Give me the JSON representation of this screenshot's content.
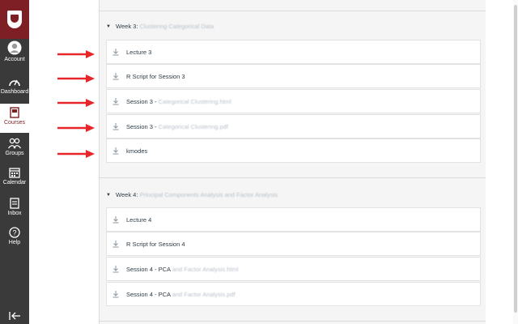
{
  "nav": {
    "items": [
      {
        "label": "Account",
        "icon": "account-icon"
      },
      {
        "label": "Dashboard",
        "icon": "dashboard-icon"
      },
      {
        "label": "Courses",
        "icon": "courses-icon",
        "active": true
      },
      {
        "label": "Groups",
        "icon": "groups-icon"
      },
      {
        "label": "Calendar",
        "icon": "calendar-icon"
      },
      {
        "label": "Inbox",
        "icon": "inbox-icon"
      },
      {
        "label": "Help",
        "icon": "help-icon"
      }
    ],
    "collapse_icon": "collapse-nav-icon"
  },
  "modules": [
    {
      "heading": "Week 3:",
      "heading_blurred": "Clustering Categorical Data",
      "items": [
        {
          "title": "Lecture 3",
          "title_blurred": ""
        },
        {
          "title": "R Script for Session 3",
          "title_blurred": ""
        },
        {
          "title": "Session 3 - ",
          "title_blurred": "Categorical Clustering.html"
        },
        {
          "title": "Session 3 - ",
          "title_blurred": "Categorical Clustering.pdf"
        },
        {
          "title": "kmodes",
          "title_blurred": ""
        }
      ]
    },
    {
      "heading": "Week 4:",
      "heading_blurred": "Principal Components Analysis and Factor Analysis",
      "items": [
        {
          "title": "Lecture 4",
          "title_blurred": ""
        },
        {
          "title": "R Script for Session 4",
          "title_blurred": ""
        },
        {
          "title": "Session 4 - PCA",
          "title_blurred": " and Factor Analysis.html"
        },
        {
          "title": "Session 4 - PCA",
          "title_blurred": " and Factor Analysis.pdf"
        }
      ]
    }
  ],
  "colors": {
    "brand": "#7d1f24",
    "nav_bg": "#3a3a3a",
    "arrow": "#e8262a"
  }
}
